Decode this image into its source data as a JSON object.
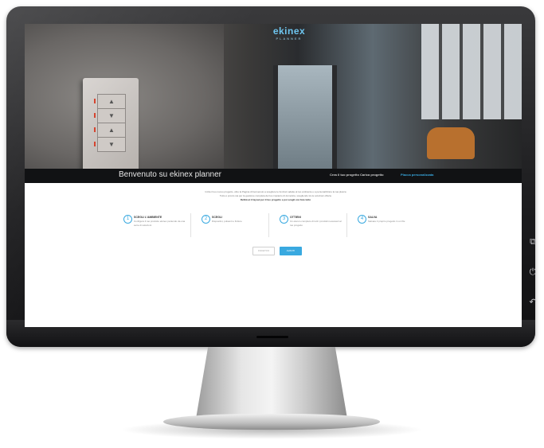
{
  "brand": {
    "name": "ekinex",
    "sub": "PLANNER"
  },
  "header": {
    "welcome": "Benvenuto su ekinex planner",
    "nav": [
      {
        "label": "Crea il tuo progetto",
        "active": false
      },
      {
        "label": "Carica progetto",
        "active": false
      },
      {
        "label": "Placca personalizzata",
        "active": true
      }
    ]
  },
  "intro": {
    "line1": "Inizia il tuo nuovo progetto, oltre la Pagina di benvenuto a scegliere le funzioni adatte al tuo ambiente e a personalizzare la tua placca",
    "line2": "Tutto è pronto sia per la gestione completa del tuo impianto di domotica, scegliendo tra le soluzioni offerte",
    "line3": "Definisci il layout per il tuo progetto e poi scegli con fare tutto"
  },
  "switch_keys": [
    "▲",
    "▼",
    "▲",
    "▼"
  ],
  "cards": [
    {
      "icon": "1",
      "title": "SCEGLI L'AMBIENTE",
      "text": "Configura il tuo prodotto ekinex partendo da una serie di soluzioni"
    },
    {
      "icon": "2",
      "title": "SCEGLI",
      "text": "Dispositivi, pulsanti e finiture"
    },
    {
      "icon": "3",
      "title": "OTTIENI",
      "text": "Un elenco completo di tutti i prodotti necessari al tuo progetto"
    },
    {
      "icon": "4",
      "title": "SALVA",
      "text": "Salvare il proprio progetto in un file"
    }
  ],
  "buttons": {
    "back": "INDIETRO",
    "next": "AVANTI"
  },
  "side_buttons": [
    "⧉",
    "⏻",
    "↶"
  ],
  "colors": {
    "accent": "#39a9e0",
    "titlebar": "#111214"
  }
}
